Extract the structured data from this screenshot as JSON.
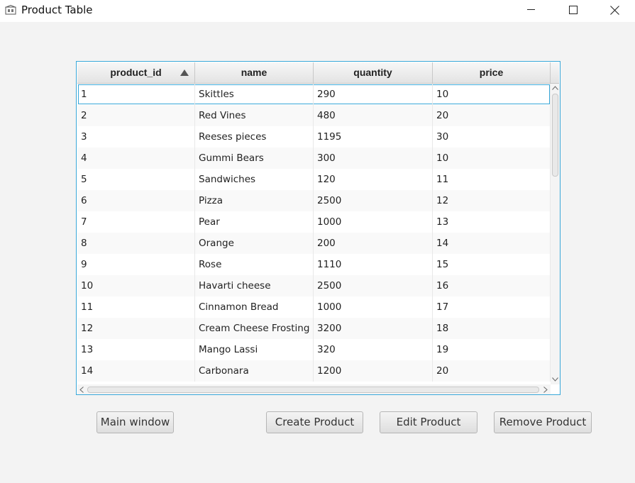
{
  "window": {
    "title": "Product Table"
  },
  "table": {
    "columns": [
      "product_id",
      "name",
      "quantity",
      "price"
    ],
    "sorted_column": "product_id",
    "sort_direction": "ascending",
    "rows": [
      [
        "1",
        "Skittles",
        "290",
        "10"
      ],
      [
        "2",
        "Red Vines",
        "480",
        "20"
      ],
      [
        "3",
        "Reeses pieces",
        "1195",
        "30"
      ],
      [
        "4",
        "Gummi Bears",
        "300",
        "10"
      ],
      [
        "5",
        "Sandwiches",
        "120",
        "11"
      ],
      [
        "6",
        "Pizza",
        "2500",
        "12"
      ],
      [
        "7",
        "Pear",
        "1000",
        "13"
      ],
      [
        "8",
        "Orange",
        "200",
        "14"
      ],
      [
        "9",
        "Rose",
        "1110",
        "15"
      ],
      [
        "10",
        "Havarti cheese",
        "2500",
        "16"
      ],
      [
        "11",
        "Cinnamon Bread",
        "1000",
        "17"
      ],
      [
        "12",
        "Cream Cheese Frosting",
        "3200",
        "18"
      ],
      [
        "13",
        "Mango Lassi",
        "320",
        "19"
      ],
      [
        "14",
        "Carbonara",
        "1200",
        "20"
      ]
    ],
    "selected_row": 0
  },
  "buttons": {
    "main_window": "Main window",
    "create_product": "Create Product",
    "edit_product": "Edit Product",
    "remove_product": "Remove Product"
  },
  "colors": {
    "focus_border": "#38a7d9",
    "background": "#f3f3f3"
  }
}
